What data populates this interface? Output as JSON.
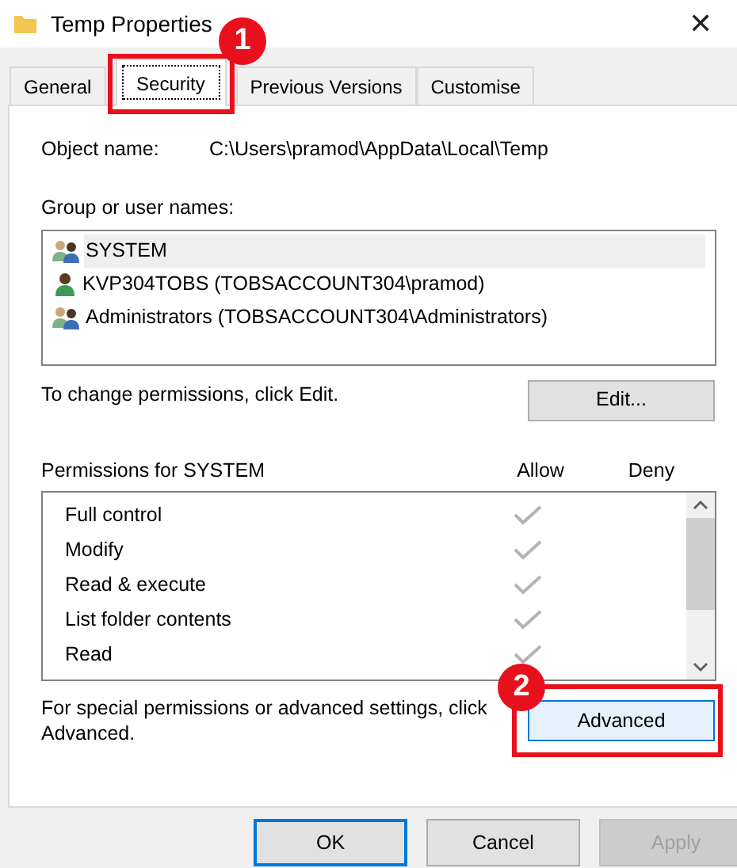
{
  "window": {
    "title": "Temp Properties",
    "close": "✕"
  },
  "tabs": [
    {
      "label": "General",
      "selected": false
    },
    {
      "label": "Security",
      "selected": true
    },
    {
      "label": "Previous Versions",
      "selected": false
    },
    {
      "label": "Customise",
      "selected": false
    }
  ],
  "object_name": {
    "label": "Object name:",
    "value": "C:\\Users\\pramod\\AppData\\Local\\Temp"
  },
  "group_list": {
    "label": "Group or user names:",
    "items": [
      {
        "name": "SYSTEM",
        "kind": "group",
        "selected": true
      },
      {
        "name": "KVP304TOBS (TOBSACCOUNT304\\pramod)",
        "kind": "user",
        "selected": false
      },
      {
        "name": "Administrators (TOBSACCOUNT304\\Administrators)",
        "kind": "group",
        "selected": false
      }
    ]
  },
  "edit_hint": "To change permissions, click Edit.",
  "edit_button": "Edit...",
  "permissions": {
    "label": "Permissions for SYSTEM",
    "columns": [
      "Allow",
      "Deny"
    ],
    "rows": [
      {
        "name": "Full control",
        "allow": true,
        "deny": false
      },
      {
        "name": "Modify",
        "allow": true,
        "deny": false
      },
      {
        "name": "Read & execute",
        "allow": true,
        "deny": false
      },
      {
        "name": "List folder contents",
        "allow": true,
        "deny": false
      },
      {
        "name": "Read",
        "allow": true,
        "deny": false
      }
    ]
  },
  "advanced_hint": "For special permissions or advanced settings, click Advanced.",
  "advanced_button": "Advanced",
  "buttons": [
    {
      "label": "OK",
      "kind": "default",
      "disabled": false
    },
    {
      "label": "Cancel",
      "kind": "normal",
      "disabled": false
    },
    {
      "label": "Apply",
      "kind": "normal",
      "disabled": true
    }
  ],
  "annotations": [
    {
      "label": "1"
    },
    {
      "label": "2"
    }
  ]
}
